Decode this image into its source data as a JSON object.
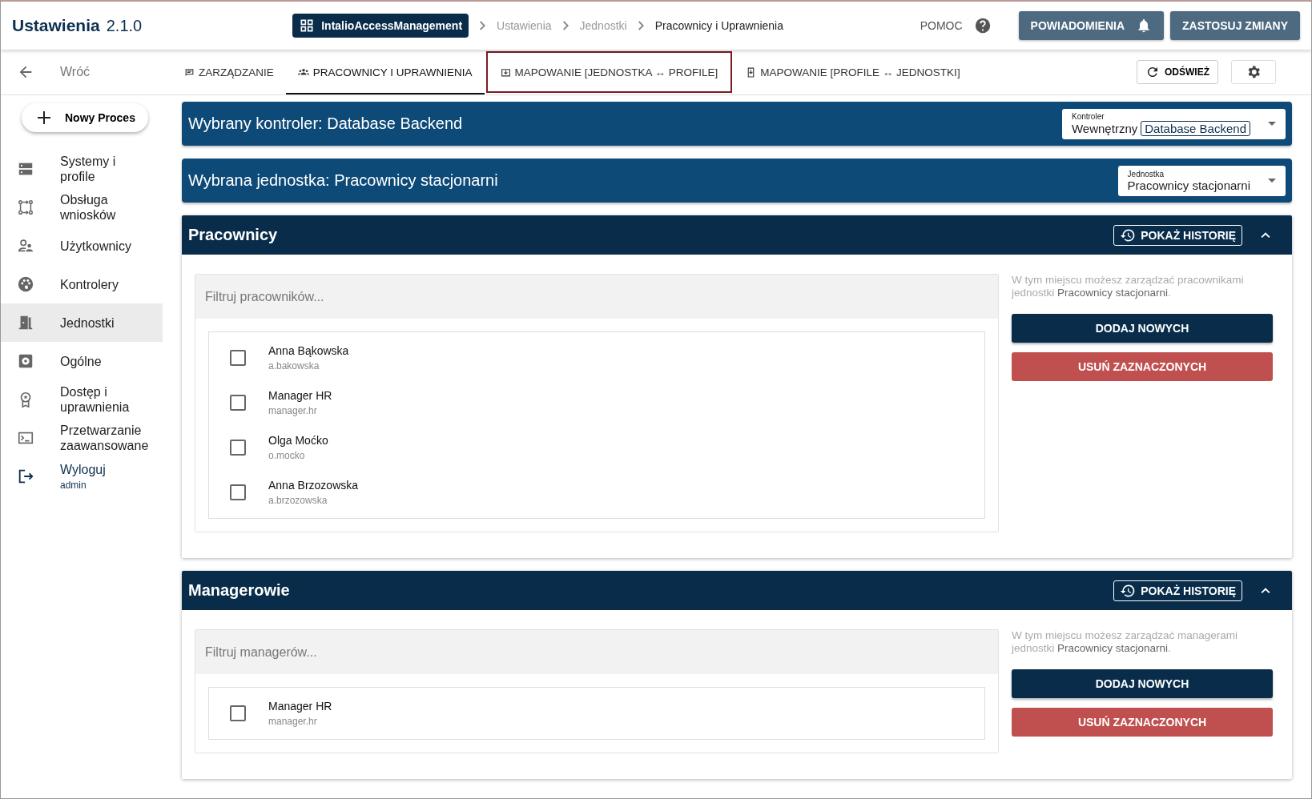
{
  "header": {
    "title": "Ustawienia",
    "version": "2.1.0",
    "app_chip": "IntalioAccessManagement",
    "breadcrumbs": [
      "Ustawienia",
      "Jednostki",
      "Pracownicy i Uprawnienia"
    ],
    "help": "POMOC",
    "notifications_button": "POWIADOMIENIA",
    "apply_button": "ZASTOSUJ ZMIANY"
  },
  "back": "Wróć",
  "tabs": [
    {
      "label": "ZARZĄDZANIE",
      "selected": false,
      "highlighted": false
    },
    {
      "label": "PRACOWNICY I UPRAWNIENIA",
      "selected": true,
      "highlighted": false
    },
    {
      "label": "MAPOWANIE [JEDNOSTKA ↔ PROFILE]",
      "selected": false,
      "highlighted": true
    },
    {
      "label": "MAPOWANIE [PROFILE ↔ JEDNOSTKI]",
      "selected": false,
      "highlighted": false
    }
  ],
  "refresh_button": "ODŚWIEŻ",
  "sidebar": {
    "new_button": "Nowy Proces",
    "items": [
      {
        "kind": "nav",
        "label": "Systemy i profile",
        "selected": false
      },
      {
        "kind": "nav",
        "label": "Obsługa wniosków",
        "selected": false
      },
      {
        "kind": "nav",
        "label": "Użytkownicy",
        "selected": false
      },
      {
        "kind": "nav",
        "label": "Kontrolery",
        "selected": false
      },
      {
        "kind": "nav",
        "label": "Jednostki",
        "selected": true
      },
      {
        "kind": "nav",
        "label": "Ogólne",
        "selected": false
      },
      {
        "kind": "nav",
        "label": "Dostęp i uprawnienia",
        "selected": false
      },
      {
        "kind": "nav",
        "label": "Przetwarzanie zaawansowane",
        "selected": false
      },
      {
        "kind": "logout",
        "label": "Wyloguj",
        "sub": "admin",
        "selected": false
      }
    ]
  },
  "controller_bar": {
    "prefix": "Wybrany kontroler:",
    "value": "Database Backend",
    "select_label": "Kontroler",
    "select_type": "Wewnętrzny",
    "select_chip": "Database Backend"
  },
  "unit_bar": {
    "prefix": "Wybrana jednostka:",
    "value": "Pracownicy stacjonarni",
    "select_label": "Jednostka",
    "select_value": "Pracownicy stacjonarni"
  },
  "panels": [
    {
      "title": "Pracownicy",
      "history_button": "POKAŻ HISTORIĘ",
      "expanded": true,
      "filter_placeholder": "Filtruj pracowników...",
      "description": "W tym miejscu możesz zarządzać pracownikami jednostki **Pracownicy stacjonarni**.",
      "add_button": "DODAJ NOWYCH",
      "remove_button": "USUŃ ZAZNACZONYCH",
      "people": [
        {
          "name": "Anna Bąkowska",
          "login": "a.bakowska",
          "checked": false
        },
        {
          "name": "Manager HR",
          "login": "manager.hr",
          "checked": false
        },
        {
          "name": "Olga Moćko",
          "login": "o.mocko",
          "checked": false
        },
        {
          "name": "Anna Brzozowska",
          "login": "a.brzozowska",
          "checked": false
        }
      ]
    },
    {
      "title": "Managerowie",
      "history_button": "POKAŻ HISTORIĘ",
      "expanded": true,
      "filter_placeholder": "Filtruj managerów...",
      "description": "W tym miejscu możesz zarządzać managerami jednostki **Pracownicy stacjonarni**.",
      "add_button": "DODAJ NOWYCH",
      "remove_button": "USUŃ ZAZNACZONYCH",
      "people": [
        {
          "name": "Manager HR",
          "login": "manager.hr",
          "checked": false
        }
      ]
    }
  ]
}
